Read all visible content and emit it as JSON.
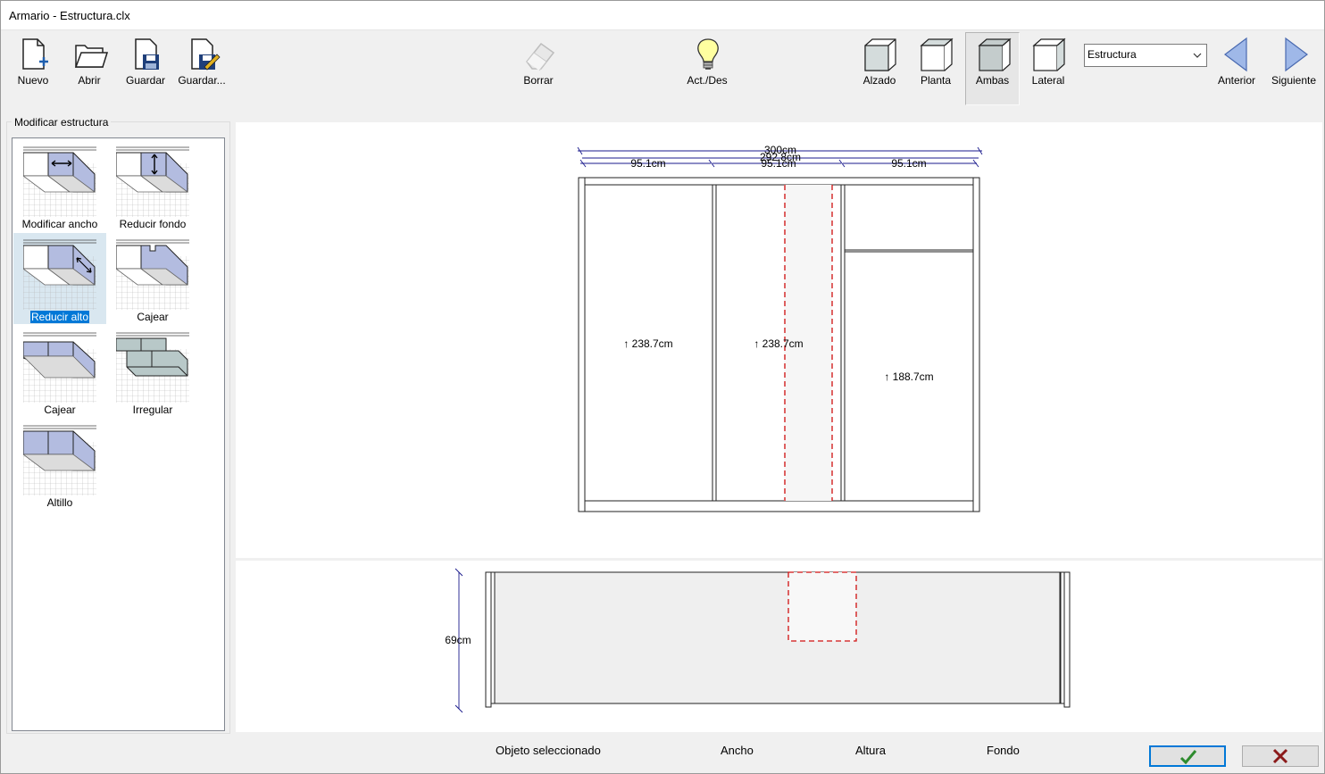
{
  "window": {
    "title": "Armario - Estructura.clx"
  },
  "toolbar": {
    "file_buttons": [
      {
        "label": "Nuevo",
        "icon": "new-file-icon"
      },
      {
        "label": "Abrir",
        "icon": "open-folder-icon"
      },
      {
        "label": "Guardar",
        "icon": "save-icon"
      },
      {
        "label": "Guardar...",
        "icon": "save-as-icon"
      }
    ],
    "delete_label": "Borrar",
    "toggle_label": "Act./Des",
    "views": [
      {
        "label": "Alzado",
        "pressed": false
      },
      {
        "label": "Planta",
        "pressed": false
      },
      {
        "label": "Ambas",
        "pressed": true
      },
      {
        "label": "Lateral",
        "pressed": false
      }
    ],
    "structure_select": {
      "value": "Estructura"
    },
    "prev_label": "Anterior",
    "next_label": "Siguiente"
  },
  "panel": {
    "title": "Modificar estructura",
    "tools": [
      {
        "label": "Modificar ancho",
        "selected": false
      },
      {
        "label": "Reducir fondo",
        "selected": false
      },
      {
        "label": "Reducir alto",
        "selected": true
      },
      {
        "label": "Cajear",
        "selected": false
      },
      {
        "label": "Cajear",
        "selected": false
      },
      {
        "label": "Irregular",
        "selected": false
      },
      {
        "label": "Altillo",
        "selected": false
      }
    ]
  },
  "drawing": {
    "total_width": "300cm",
    "inner_width": "292.8cm",
    "module_widths": [
      "95.1cm",
      "95.1cm",
      "95.1cm"
    ],
    "module_heights": [
      "↑ 238.7cm",
      "↑ 238.7cm",
      "↑ 188.7cm"
    ],
    "depth": "69cm"
  },
  "status": {
    "selected_object_label": "Objeto seleccionado",
    "width_label": "Ancho",
    "height_label": "Altura",
    "depth_label": "Fondo"
  },
  "colors": {
    "accent": "#0078d7",
    "selection": "#d9e7f0",
    "ok_check": "#2e8b2e",
    "cancel_x": "#8b1a1a",
    "dashed": "#d01010",
    "dimension": "#1a1a8c"
  }
}
